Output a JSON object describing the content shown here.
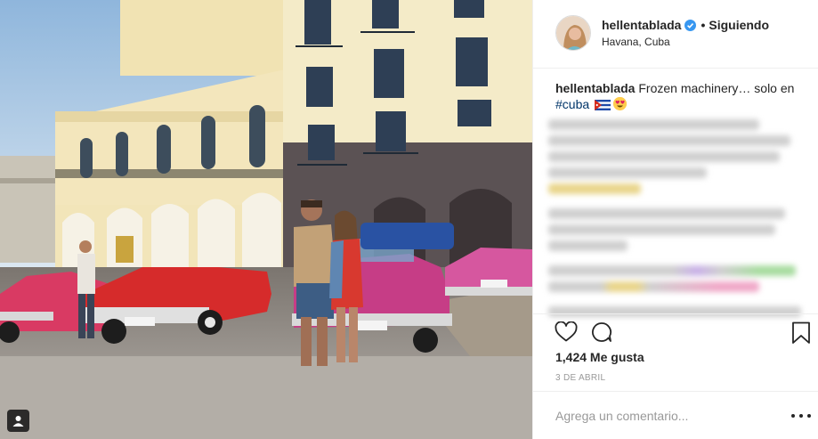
{
  "post": {
    "username": "hellentablada",
    "separator": "•",
    "follow_status": "Siguiendo",
    "location": "Havana, Cuba",
    "caption": {
      "user": "hellentablada",
      "text_before": " Frozen machinery… solo en",
      "hashtag": "#cuba"
    },
    "likes": "1,424 Me gusta",
    "date": "3 DE ABRIL",
    "comment_placeholder": "Agrega un comentario..."
  },
  "icons": {
    "verified": "verified-badge-icon",
    "like": "heart-outline-icon",
    "comment": "comment-bubble-icon",
    "save": "bookmark-icon",
    "more": "more-options-icon",
    "tag": "user-tag-icon",
    "flag": "cuba-flag-icon",
    "emoji": "heart-eyes-emoji-icon"
  },
  "colors": {
    "verified_blue": "#3897f0",
    "hashtag": "#003569",
    "muted_text": "#999999",
    "border": "#efefef"
  }
}
